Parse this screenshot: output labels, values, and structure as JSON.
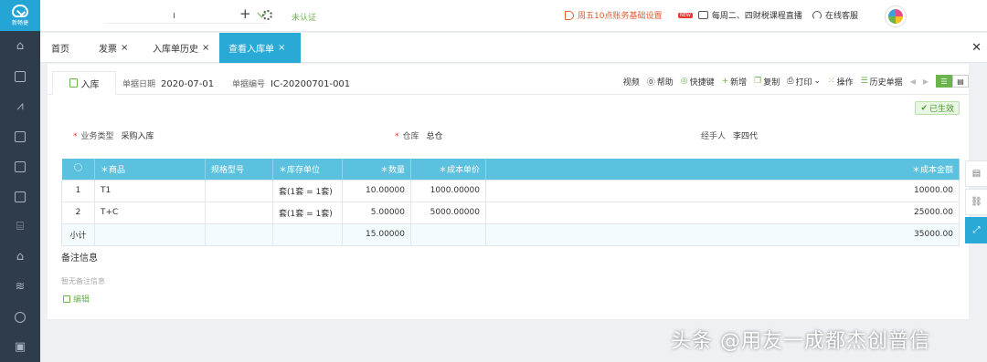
{
  "sidebar": {
    "brand": "新畅捷",
    "items": [
      "home-icon",
      "document-icon",
      "chart-icon",
      "bag-icon",
      "building-icon",
      "calculator-icon",
      "store-icon",
      "house-icon",
      "stack-icon",
      "settings-icon",
      "media-icon"
    ]
  },
  "topbar": {
    "cert_status": "未认证",
    "notice": "周五10点账务基础设置",
    "new_badge": "NEW",
    "live": "每周二、四财税课程直播",
    "service": "在线客服"
  },
  "tabs": [
    {
      "label": "首页",
      "closable": false,
      "active": false
    },
    {
      "label": "发票",
      "closable": true,
      "active": false
    },
    {
      "label": "入库单历史",
      "closable": true,
      "active": false
    },
    {
      "label": "查看入库单",
      "closable": true,
      "active": true
    }
  ],
  "doc": {
    "tab_label": "入库",
    "date_label": "单据日期",
    "date_value": "2020-07-01",
    "no_label": "单据编号",
    "no_value": "IC-20200701-001",
    "status": "已生效"
  },
  "toolbar": {
    "video": "视频",
    "help": "帮助",
    "shortcut": "快捷键",
    "add": "新增",
    "copy": "复制",
    "print": "打印",
    "operate": "操作",
    "history": "历史单据"
  },
  "fields": {
    "biz_type_label": "业务类型",
    "biz_type_value": "采购入库",
    "warehouse_label": "仓库",
    "warehouse_value": "总仓",
    "handler_label": "经手人",
    "handler_value": "李四代"
  },
  "table": {
    "headers": [
      "＊商品",
      "规格型号",
      "＊库存单位",
      "＊数量",
      "＊成本单价",
      "＊成本金额"
    ],
    "rows": [
      {
        "no": "1",
        "product": "T1",
        "spec": "",
        "unit": "套(1套 = 1套)",
        "qty": "10.00000",
        "price": "1000.00000",
        "amount": "10000.00"
      },
      {
        "no": "2",
        "product": "T+C",
        "spec": "",
        "unit": "套(1套 = 1套)",
        "qty": "5.00000",
        "price": "5000.00000",
        "amount": "25000.00"
      }
    ],
    "subtotal_label": "小计",
    "subtotal_qty": "15.00000",
    "subtotal_amount": "35000.00"
  },
  "remark": {
    "title": "备注信息",
    "empty": "暂无备注信息",
    "edit": "编辑"
  },
  "watermark": "头条 @用友一成都杰创普信",
  "colors": {
    "sidebar": "#2f3c4c",
    "accent_blue": "#29a9d6",
    "table_header": "#5bc1df",
    "accent_green": "#6bb34b",
    "notice_orange": "#e05d2e"
  }
}
